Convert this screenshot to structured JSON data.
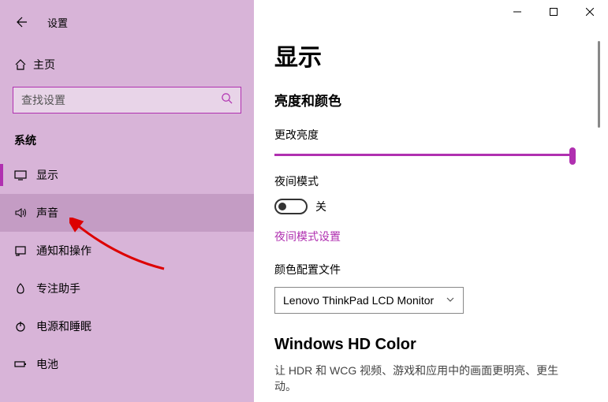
{
  "app": {
    "title": "设置"
  },
  "home": {
    "label": "主页"
  },
  "search": {
    "placeholder": "查找设置"
  },
  "section": {
    "label": "系统"
  },
  "nav": {
    "items": [
      {
        "label": "显示"
      },
      {
        "label": "声音"
      },
      {
        "label": "通知和操作"
      },
      {
        "label": "专注助手"
      },
      {
        "label": "电源和睡眠"
      },
      {
        "label": "电池"
      }
    ]
  },
  "page": {
    "title": "显示",
    "brightness_section": "亮度和颜色",
    "brightness_label": "更改亮度",
    "night_mode_label": "夜间模式",
    "night_mode_state": "关",
    "night_mode_link": "夜间模式设置",
    "color_profile_label": "颜色配置文件",
    "color_profile_value": "Lenovo ThinkPad LCD Monitor",
    "hd_heading": "Windows HD Color",
    "hd_descr": "让 HDR 和 WCG 视频、游戏和应用中的画面更明亮、更生动。"
  }
}
